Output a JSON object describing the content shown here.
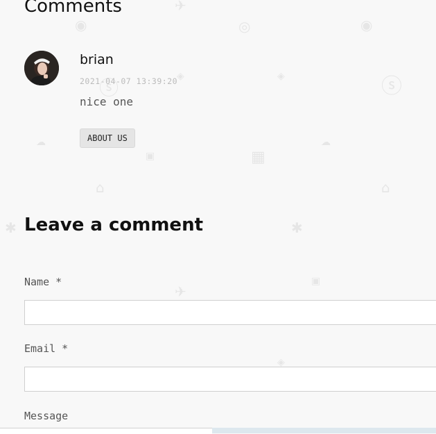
{
  "comments_section": {
    "title": "Comments"
  },
  "comment": {
    "author": "brian",
    "date": "2021-04-07 13:39:20",
    "body": "nice one",
    "tag_label": "ABOUT US"
  },
  "form": {
    "title": "Leave a comment",
    "name_label": "Name *",
    "email_label": "Email *",
    "message_label": "Message",
    "name_value": "",
    "email_value": ""
  },
  "colors": {
    "background": "#f8f8f8",
    "tag_bg": "#e5e5e5",
    "input_border": "#cfcfcf"
  },
  "icons": [
    "camera-icon",
    "eye-icon",
    "plane-icon",
    "cloud-icon",
    "house-icon",
    "bug-icon",
    "sun-icon",
    "chip-icon",
    "diamond-icon",
    "bolt-icon"
  ]
}
